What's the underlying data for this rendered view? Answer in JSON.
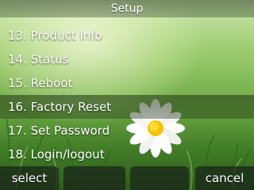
{
  "header": {
    "title": "Setup"
  },
  "menu": {
    "items": [
      {
        "label": "13. Product Info"
      },
      {
        "label": "14. Status"
      },
      {
        "label": "15. Reboot"
      },
      {
        "label": "16. Factory Reset",
        "selected": true
      },
      {
        "label": "17. Set Password"
      },
      {
        "label": "18. Login/logout"
      }
    ]
  },
  "softkeys": {
    "left": "select",
    "middle_left": "",
    "middle_right": "",
    "right": "cancel"
  },
  "colors": {
    "highlight": "#2a3c1e",
    "softkey_bg": "#19231a",
    "text": "#ffffff"
  },
  "wallpaper": {
    "icon": "daisy-grass-wallpaper"
  }
}
